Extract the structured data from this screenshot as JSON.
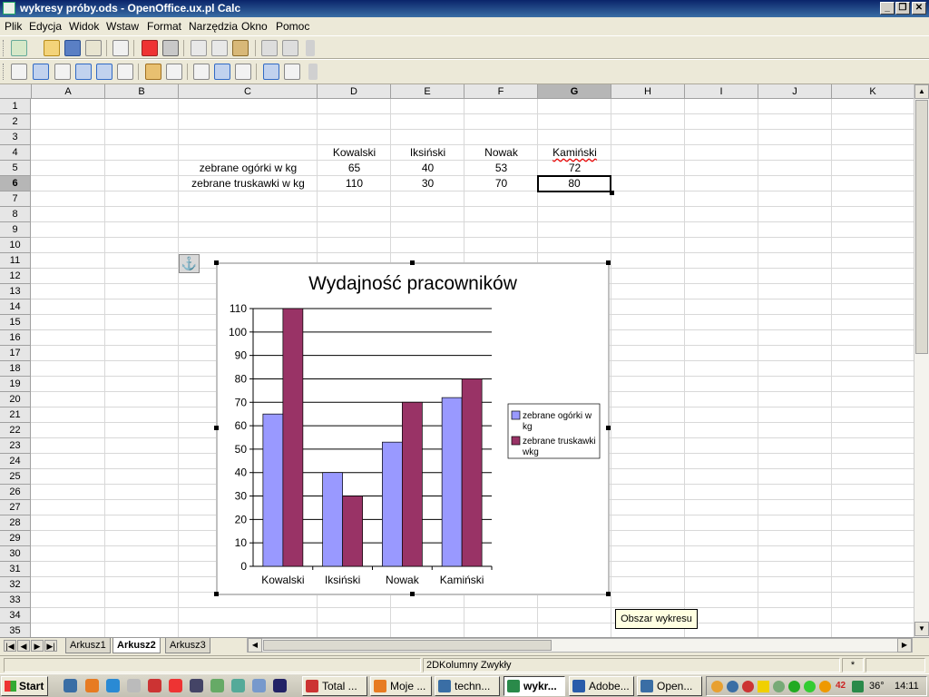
{
  "window": {
    "title": "wykresy próby.ods - OpenOffice.ux.pl Calc",
    "minimize": "_",
    "restore": "❐",
    "close": "✕"
  },
  "menu": [
    "Plik",
    "Edycja",
    "Widok",
    "Wstaw",
    "Format",
    "Narzędzia",
    "Okno",
    "Pomoc"
  ],
  "columns": [
    "A",
    "B",
    "C",
    "D",
    "E",
    "F",
    "G",
    "H",
    "I",
    "J",
    "K"
  ],
  "selected_column": "G",
  "selected_row": "6",
  "rows": [
    "1",
    "2",
    "3",
    "4",
    "5",
    "6",
    "7",
    "8",
    "9",
    "10",
    "11",
    "12",
    "13",
    "14",
    "15",
    "16",
    "17",
    "18",
    "19",
    "20",
    "21",
    "22",
    "23",
    "24",
    "25",
    "26",
    "27",
    "28",
    "29",
    "30",
    "31",
    "32",
    "33",
    "34",
    "35"
  ],
  "table": {
    "headers": [
      "Kowalski",
      "Iksiński",
      "Nowak",
      "Kamiński"
    ],
    "row5_label": "zebrane ogórki w kg",
    "row5_values": [
      "65",
      "40",
      "53",
      "72"
    ],
    "row6_label": "zebrane truskawki w kg",
    "row6_values": [
      "110",
      "30",
      "70",
      "80"
    ]
  },
  "chart_data": {
    "type": "bar",
    "title": "Wydajność pracowników",
    "categories": [
      "Kowalski",
      "Iksiński",
      "Nowak",
      "Kamiński"
    ],
    "series": [
      {
        "name": "zebrane ogórki w kg",
        "values": [
          65,
          40,
          53,
          72
        ],
        "color": "#9999ff"
      },
      {
        "name": "zebrane truskawki w kg",
        "values": [
          110,
          30,
          70,
          80
        ],
        "color": "#993366"
      }
    ],
    "legend_lines": [
      [
        "zebrane ogórki w",
        "kg"
      ],
      [
        "zebrane truskawki",
        "wkg"
      ]
    ],
    "ylim": [
      0,
      110
    ],
    "yticks": [
      "0",
      "10",
      "20",
      "30",
      "40",
      "50",
      "60",
      "70",
      "80",
      "90",
      "100",
      "110"
    ],
    "grid": true,
    "legend_position": "right"
  },
  "sheet_tabs": [
    "Arkusz1",
    "Arkusz2",
    "Arkusz3"
  ],
  "active_tab": "Arkusz2",
  "status": {
    "chart_type": "2DKolumny Zwykły",
    "modified": "*"
  },
  "tooltip": "Obszar wykresu",
  "anchor_glyph": "⚓",
  "taskbar": {
    "start": "Start",
    "buttons": [
      {
        "label": "Total ...",
        "color": "#c33"
      },
      {
        "label": "Moje ...",
        "color": "#e77b22"
      },
      {
        "label": "techn...",
        "color": "#3a6ea5"
      },
      {
        "label": "wykr...",
        "color": "#2a8a4a",
        "active": true
      },
      {
        "label": "Adobe...",
        "color": "#2a5caa"
      },
      {
        "label": "Open...",
        "color": "#3a6ea5"
      }
    ],
    "tray_temp": "36°",
    "tray_time": "14:11",
    "tray_badge": "42"
  }
}
